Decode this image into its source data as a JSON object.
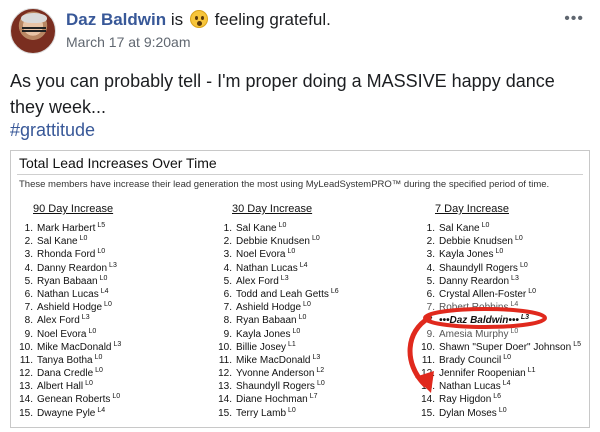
{
  "post": {
    "author": "Daz Baldwin",
    "is_text": "is",
    "feeling_emoji": "smiling-face-emoji",
    "feeling_text": "feeling grateful.",
    "timestamp": "March 17 at 9:20am",
    "more_label": "•••",
    "text": "As you can probably tell - I'm proper doing a MASSIVE happy dance they week...",
    "hashtag": "#grattitude"
  },
  "report": {
    "title": "Total Lead Increases Over Time",
    "subtitle": "These members have increase their lead generation the most using MyLeadSystemPRO™ during the specified period of time.",
    "columns": [
      {
        "heading": "90 Day Increase",
        "entries": [
          {
            "num": "1.",
            "name": "Mark Harbert",
            "level": "L5"
          },
          {
            "num": "2.",
            "name": "Sal Kane",
            "level": "L0"
          },
          {
            "num": "3.",
            "name": "Rhonda Ford",
            "level": "L0"
          },
          {
            "num": "4.",
            "name": "Danny Reardon",
            "level": "L3"
          },
          {
            "num": "5.",
            "name": "Ryan Babaan",
            "level": "L0"
          },
          {
            "num": "6.",
            "name": "Nathan Lucas",
            "level": "L4"
          },
          {
            "num": "7.",
            "name": "Ashield Hodge",
            "level": "L0"
          },
          {
            "num": "8.",
            "name": "Alex Ford",
            "level": "L3"
          },
          {
            "num": "9.",
            "name": "Noel Evora",
            "level": "L0"
          },
          {
            "num": "10.",
            "name": "Mike MacDonald",
            "level": "L3"
          },
          {
            "num": "11.",
            "name": "Tanya Botha",
            "level": "L0"
          },
          {
            "num": "12.",
            "name": "Dana Credle",
            "level": "L0"
          },
          {
            "num": "13.",
            "name": "Albert Hall",
            "level": "L0"
          },
          {
            "num": "14.",
            "name": "Genean Roberts",
            "level": "L0"
          },
          {
            "num": "15.",
            "name": "Dwayne Pyle",
            "level": "L4"
          }
        ]
      },
      {
        "heading": "30 Day Increase",
        "entries": [
          {
            "num": "1.",
            "name": "Sal Kane",
            "level": "L0"
          },
          {
            "num": "2.",
            "name": "Debbie Knudsen",
            "level": "L0"
          },
          {
            "num": "3.",
            "name": "Noel Evora",
            "level": "L0"
          },
          {
            "num": "4.",
            "name": "Nathan Lucas",
            "level": "L4"
          },
          {
            "num": "5.",
            "name": "Alex Ford",
            "level": "L3"
          },
          {
            "num": "6.",
            "name": "Todd and Leah Getts",
            "level": "L6"
          },
          {
            "num": "7.",
            "name": "Ashield Hodge",
            "level": "L0"
          },
          {
            "num": "8.",
            "name": "Ryan Babaan",
            "level": "L0"
          },
          {
            "num": "9.",
            "name": "Kayla Jones",
            "level": "L0"
          },
          {
            "num": "10.",
            "name": "Billie Josey",
            "level": "L1"
          },
          {
            "num": "11.",
            "name": "Mike MacDonald",
            "level": "L3"
          },
          {
            "num": "12.",
            "name": "Yvonne Anderson",
            "level": "L2"
          },
          {
            "num": "13.",
            "name": "Shaundyll Rogers",
            "level": "L0"
          },
          {
            "num": "14.",
            "name": "Diane Hochman",
            "level": "L7"
          },
          {
            "num": "15.",
            "name": "Terry Lamb",
            "level": "L0"
          }
        ]
      },
      {
        "heading": "7 Day Increase",
        "entries": [
          {
            "num": "1.",
            "name": "Sal Kane",
            "level": "L0"
          },
          {
            "num": "2.",
            "name": "Debbie Knudsen",
            "level": "L0"
          },
          {
            "num": "3.",
            "name": "Kayla Jones",
            "level": "L0"
          },
          {
            "num": "4.",
            "name": "Shaundyll Rogers",
            "level": "L0"
          },
          {
            "num": "5.",
            "name": "Danny Reardon",
            "level": "L3"
          },
          {
            "num": "6.",
            "name": "Crystal Allen-Foster",
            "level": "L0"
          },
          {
            "num": "7.",
            "name": "Robert Robbins",
            "level": "L4"
          },
          {
            "num": "8.",
            "name": "•••Daz Baldwin•••",
            "level": "L3"
          },
          {
            "num": "9.",
            "name": "Amesia Murphy",
            "level": "L0"
          },
          {
            "num": "10.",
            "name": "Shawn \"Super Doer\" Johnson",
            "level": "L5"
          },
          {
            "num": "11.",
            "name": "Brady Council",
            "level": "L0"
          },
          {
            "num": "12.",
            "name": "Jennifer Roopenian",
            "level": "L1"
          },
          {
            "num": "13.",
            "name": "Nathan Lucas",
            "level": "L4"
          },
          {
            "num": "14.",
            "name": "Ray Higdon",
            "level": "L6"
          },
          {
            "num": "15.",
            "name": "Dylan Moses",
            "level": "L0"
          }
        ]
      }
    ],
    "highlight_color": "#e0291d"
  },
  "colors": {
    "link_blue": "#385898",
    "text": "#1c1e21",
    "meta": "#606770"
  }
}
